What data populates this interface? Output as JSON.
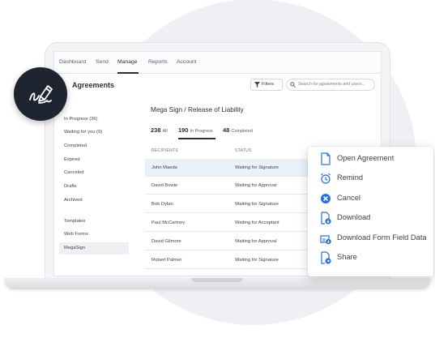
{
  "nav": {
    "items": [
      {
        "label": "Dashboard"
      },
      {
        "label": "Send"
      },
      {
        "label": "Manage"
      },
      {
        "label": "Reports"
      },
      {
        "label": "Account"
      }
    ],
    "active": "Manage"
  },
  "page": {
    "title": "Agreements",
    "filters_label": "Filters",
    "search_placeholder": "Search for agreements and users..."
  },
  "sidebar": {
    "items": [
      {
        "label": "In Progress (36)"
      },
      {
        "label": "Waiting for you (9)"
      },
      {
        "label": "Completed"
      },
      {
        "label": "Expired"
      },
      {
        "label": "Canceled"
      },
      {
        "label": "Drafts"
      },
      {
        "label": "Archived"
      },
      {
        "label": "Templates"
      },
      {
        "label": "Web Forms"
      },
      {
        "label": "MegaSign"
      }
    ],
    "selected": "MegaSign"
  },
  "main": {
    "agreement_title": "Mega Sign / Release of Liability",
    "tabs": [
      {
        "count": "238",
        "label": "All"
      },
      {
        "count": "190",
        "label": "In Progress"
      },
      {
        "count": "48",
        "label": "Completed"
      }
    ],
    "active_tab": "In Progress",
    "columns": [
      "RECIPIENTS",
      "STATUS"
    ],
    "rows": [
      {
        "recipient": "John Maeda",
        "status": "Waiting for Signature"
      },
      {
        "recipient": "David Bowie",
        "status": "Waiting for Approval"
      },
      {
        "recipient": "Bob Dylan",
        "status": "Waiting for Signature"
      },
      {
        "recipient": "Paul McCartney",
        "status": "Waiting for Acceptant"
      },
      {
        "recipient": "David Gilmore",
        "status": "Waiting for Approval"
      },
      {
        "recipient": "Robert Palmer",
        "status": "Waiting for Signature"
      }
    ],
    "highlighted_row": "John Maeda"
  },
  "context_menu": {
    "items": [
      {
        "label": "Open Agreement",
        "icon": "document-icon"
      },
      {
        "label": "Remind",
        "icon": "alarm-clock-icon"
      },
      {
        "label": "Cancel",
        "icon": "cancel-circle-icon"
      },
      {
        "label": "Download",
        "icon": "download-document-icon"
      },
      {
        "label": "Download Form Field Data",
        "icon": "download-data-icon"
      },
      {
        "label": "Share",
        "icon": "share-document-icon"
      }
    ]
  },
  "colors": {
    "badge_bg": "#1f2431",
    "accent_blue": "#2b6fd6",
    "row_highlight": "#e9f1fb",
    "bg_circle": "#eef0f4"
  }
}
